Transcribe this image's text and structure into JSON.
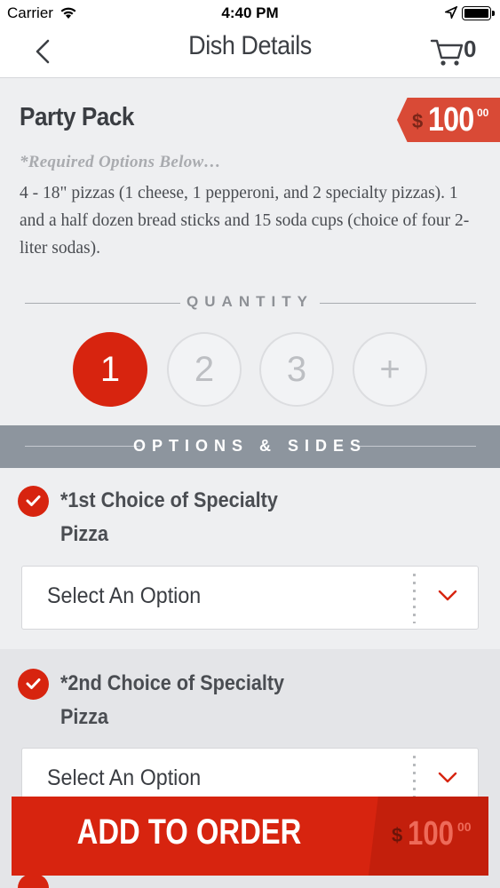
{
  "status_bar": {
    "carrier": "Carrier",
    "time": "4:40 PM"
  },
  "nav": {
    "title": "Dish Details",
    "cart_count": "0"
  },
  "dish": {
    "name": "Party Pack",
    "price_currency": "$",
    "price_amount": "100",
    "price_cents": "00",
    "required_note": "*Required Options Below…",
    "description": "4 - 18\" pizzas (1 cheese, 1 pepperoni, and 2 specialty pizzas). 1 and a half dozen bread sticks and 15 soda cups (choice of four 2-liter sodas)."
  },
  "quantity": {
    "label": "QUANTITY",
    "options": [
      "1",
      "2",
      "3",
      "+"
    ],
    "selected": "1"
  },
  "options": {
    "header": "OPTIONS & SIDES",
    "groups": [
      {
        "name": "*1st Choice of Specialty Pizza",
        "placeholder": "Select An Option"
      },
      {
        "name": "*2nd Choice of Specialty Pizza",
        "placeholder": "Select An Option"
      }
    ]
  },
  "add_to_order": {
    "label": "ADD TO ORDER",
    "currency": "$",
    "amount": "100",
    "cents": "00"
  },
  "colors": {
    "accent": "#d7240f",
    "header_band": "#8d959e",
    "price_tag": "#d94a36"
  }
}
